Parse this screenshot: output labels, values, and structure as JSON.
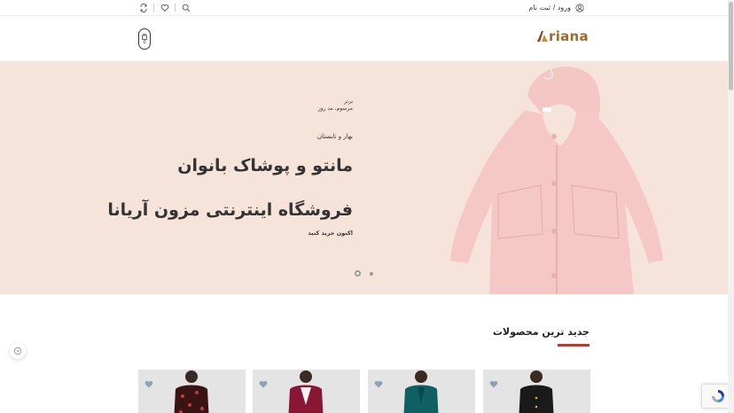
{
  "topbar": {
    "icons": [
      "refresh-icon",
      "heart-icon",
      "search-icon"
    ],
    "auth_label": "ورود / ثبت نام",
    "auth_icon": "user-icon"
  },
  "header": {
    "logo_text": "riana",
    "cart_count": "0"
  },
  "hero": {
    "category_1": "برتر",
    "category_2": "مرسوم، مد روز",
    "season": "بهار و تابستان",
    "headline_1": "مانتو و پوشاک بانوان",
    "headline_2": "فروشگاه اینترنتی مزون آریانا",
    "cta_label": "اکنون خرید کنید",
    "background": "#f6e3da",
    "slides": 2,
    "active_slide": 1
  },
  "section": {
    "title": "جدید ترین محصولات",
    "accent": "#c0392b"
  },
  "products": [
    {
      "name": "product-1",
      "color": "#3a1414",
      "wish_icon": "heart-icon"
    },
    {
      "name": "product-2",
      "color": "#8b1535",
      "wish_icon": "heart-icon"
    },
    {
      "name": "product-3",
      "color": "#0f5f63",
      "wish_icon": "heart-icon"
    },
    {
      "name": "product-4",
      "color": "#1a1a1a",
      "wish_icon": "heart-icon"
    }
  ]
}
